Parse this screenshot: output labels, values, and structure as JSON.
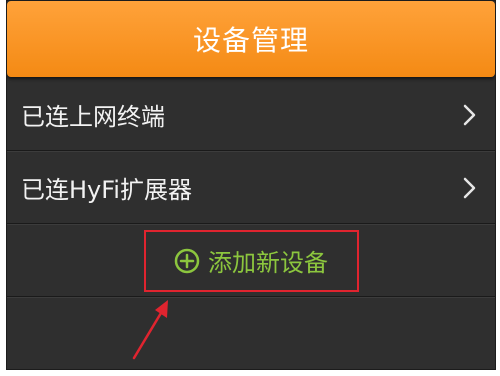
{
  "header": {
    "title": "设备管理"
  },
  "menu": {
    "items": [
      {
        "label": "已连上网终端"
      },
      {
        "label": "已连HyFi扩展器"
      }
    ]
  },
  "actions": {
    "add_device_label": "添加新设备"
  },
  "colors": {
    "header_orange": "#f7931e",
    "background_dark": "#2f2f2f",
    "add_green": "#8cc63e",
    "annotation_red": "#e0242f"
  }
}
